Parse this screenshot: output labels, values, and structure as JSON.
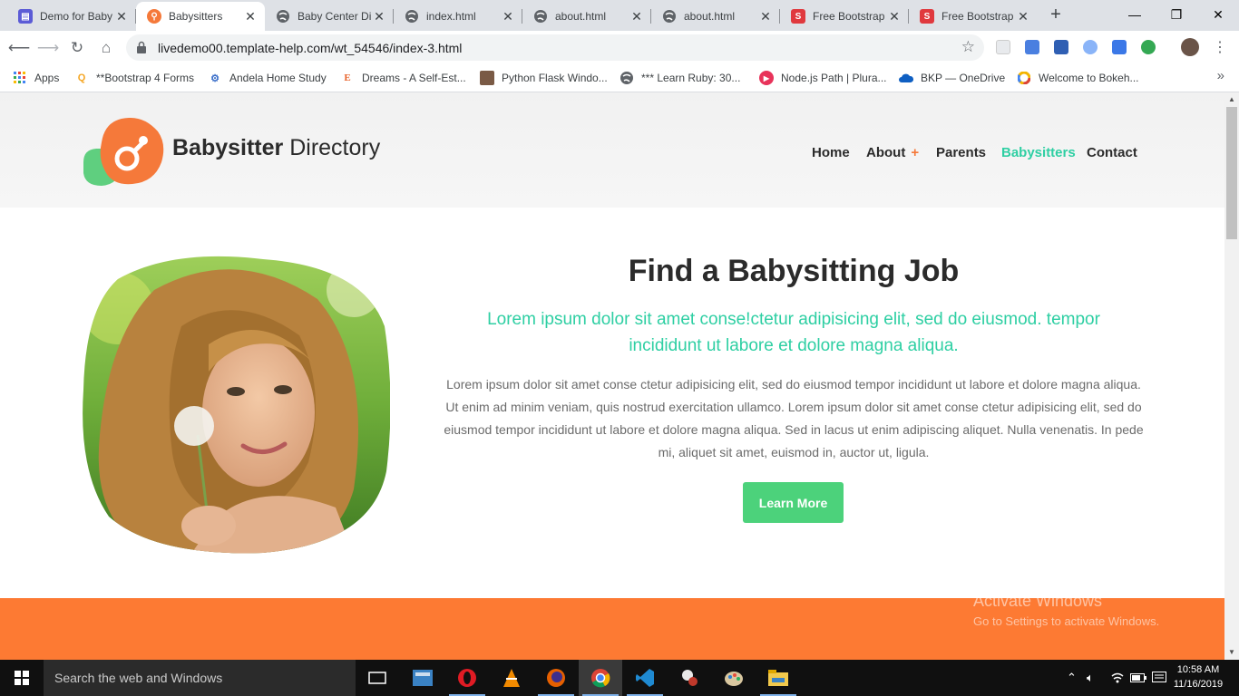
{
  "browser": {
    "tabs": [
      {
        "title": "Demo for Baby",
        "favicon": "form-icon",
        "color": "#5b5bd6",
        "active": false
      },
      {
        "title": "Babysitters",
        "favicon": "babysitter-logo-icon",
        "color": "#f5793a",
        "active": true
      },
      {
        "title": "Baby Center Di",
        "favicon": "globe-icon",
        "color": "#5f6368",
        "active": false
      },
      {
        "title": "index.html",
        "favicon": "globe-icon",
        "color": "#5f6368",
        "active": false
      },
      {
        "title": "about.html",
        "favicon": "globe-icon",
        "color": "#5f6368",
        "active": false
      },
      {
        "title": "about.html",
        "favicon": "globe-icon",
        "color": "#5f6368",
        "active": false
      },
      {
        "title": "Free Bootstrap",
        "favicon": "s-icon",
        "color": "#e0393e",
        "active": false
      },
      {
        "title": "Free Bootstrap",
        "favicon": "s-icon",
        "color": "#e0393e",
        "active": false
      }
    ],
    "new_tab_label": "+",
    "url": "livedemo00.template-help.com/wt_54546/index-3.html",
    "bookmarks": [
      {
        "label": "Apps",
        "icon": "apps-grid-icon"
      },
      {
        "label": "**Bootstrap 4 Forms",
        "icon": "search-orange-icon"
      },
      {
        "label": "Andela Home Study",
        "icon": "gear-icon"
      },
      {
        "label": "Dreams - A Self-Est...",
        "icon": "e-icon"
      },
      {
        "label": "Python Flask Windo...",
        "icon": "photo-icon"
      },
      {
        "label": "*** Learn Ruby: 30...",
        "icon": "globe-icon"
      },
      {
        "label": "Node.js Path | Plura...",
        "icon": "play-icon"
      },
      {
        "label": "BKP — OneDrive",
        "icon": "cloud-icon"
      },
      {
        "label": "Welcome to Bokeh...",
        "icon": "bokeh-icon"
      }
    ]
  },
  "site": {
    "brand_bold": "Babysitter",
    "brand_rest": " Directory",
    "nav": [
      {
        "label": "Home",
        "active": false
      },
      {
        "label": "About",
        "active": false,
        "has_submenu": true
      },
      {
        "label": "Parents",
        "active": false
      },
      {
        "label": "Babysitters",
        "active": true
      },
      {
        "label": "Contact",
        "active": false
      }
    ],
    "submenu_marker": "+",
    "hero": {
      "title": "Find a Babysitting Job",
      "lead": "Lorem ipsum dolor sit amet conse!ctetur adipisicing elit, sed do eiusmod. tempor incididunt ut labore et dolore magna aliqua.",
      "body": "Lorem ipsum dolor sit amet conse ctetur adipisicing elit, sed do eiusmod tempor incididunt ut labore et dolore magna aliqua. Ut enim ad minim veniam, quis nostrud exercitation ullamco. Lorem ipsum dolor sit amet conse ctetur adipisicing elit, sed do eiusmod tempor incididunt ut labore et dolore magna aliqua. Sed in lacus ut enim adipiscing aliquet. Nulla venenatis. In pede mi, aliquet sit amet, euismod in, auctor ut, ligula.",
      "button": "Learn More"
    },
    "colors": {
      "accent_green": "#2ecfa3",
      "button_green": "#4cd27b",
      "orange": "#fd7a33"
    }
  },
  "windows": {
    "watermark_title": "Activate Windows",
    "watermark_sub": "Go to Settings to activate Windows.",
    "search_placeholder": "Search the web and Windows",
    "time": "10:58 AM",
    "date": "11/16/2019"
  }
}
